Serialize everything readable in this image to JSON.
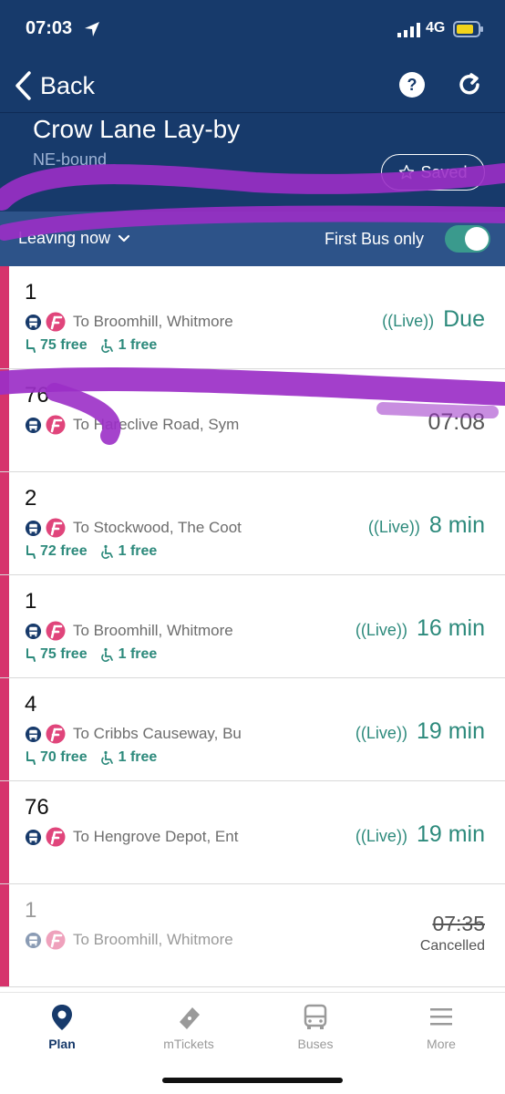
{
  "status_bar": {
    "time": "07:03",
    "network": "4G"
  },
  "nav": {
    "back_label": "Back"
  },
  "stop": {
    "name": "Crow Lane Lay-by",
    "direction": "NE-bound",
    "saved_label": "Saved"
  },
  "filters": {
    "leaving_label": "Leaving now",
    "first_bus_label": "First Bus only",
    "first_bus_only": true
  },
  "live_label": "Live",
  "departures": [
    {
      "route": "1",
      "destination": "To Broomhill, Whitmore",
      "live": true,
      "eta": "Due",
      "seats_free": "75 free",
      "wheelchair_free": "1 free"
    },
    {
      "route": "76",
      "destination": "To Hareclive Road, Sym",
      "live": false,
      "eta": "07:08"
    },
    {
      "route": "2",
      "destination": "To Stockwood, The Coot",
      "live": true,
      "eta": "8 min",
      "seats_free": "72 free",
      "wheelchair_free": "1 free"
    },
    {
      "route": "1",
      "destination": "To Broomhill, Whitmore",
      "live": true,
      "eta": "16 min",
      "seats_free": "75 free",
      "wheelchair_free": "1 free"
    },
    {
      "route": "4",
      "destination": "To Cribbs Causeway, Bu",
      "live": true,
      "eta": "19 min",
      "seats_free": "70 free",
      "wheelchair_free": "1 free"
    },
    {
      "route": "76",
      "destination": "To Hengrove Depot, Ent",
      "live": true,
      "eta": "19 min"
    },
    {
      "route": "1",
      "destination": "To Broomhill, Whitmore",
      "cancelled": true,
      "scheduled_time": "07:35",
      "status": "Cancelled"
    }
  ],
  "tabs": [
    {
      "label": "Plan",
      "icon": "location-pin-icon",
      "active": true
    },
    {
      "label": "mTickets",
      "icon": "ticket-icon",
      "active": false
    },
    {
      "label": "Buses",
      "icon": "bus-icon",
      "active": false
    },
    {
      "label": "More",
      "icon": "menu-icon",
      "active": false
    }
  ],
  "colors": {
    "header": "#173a6b",
    "filter_bar": "#2d5389",
    "accent": "#2d8a7c",
    "route_bar": "#d6336c",
    "scribble": "#9b2fc7"
  }
}
